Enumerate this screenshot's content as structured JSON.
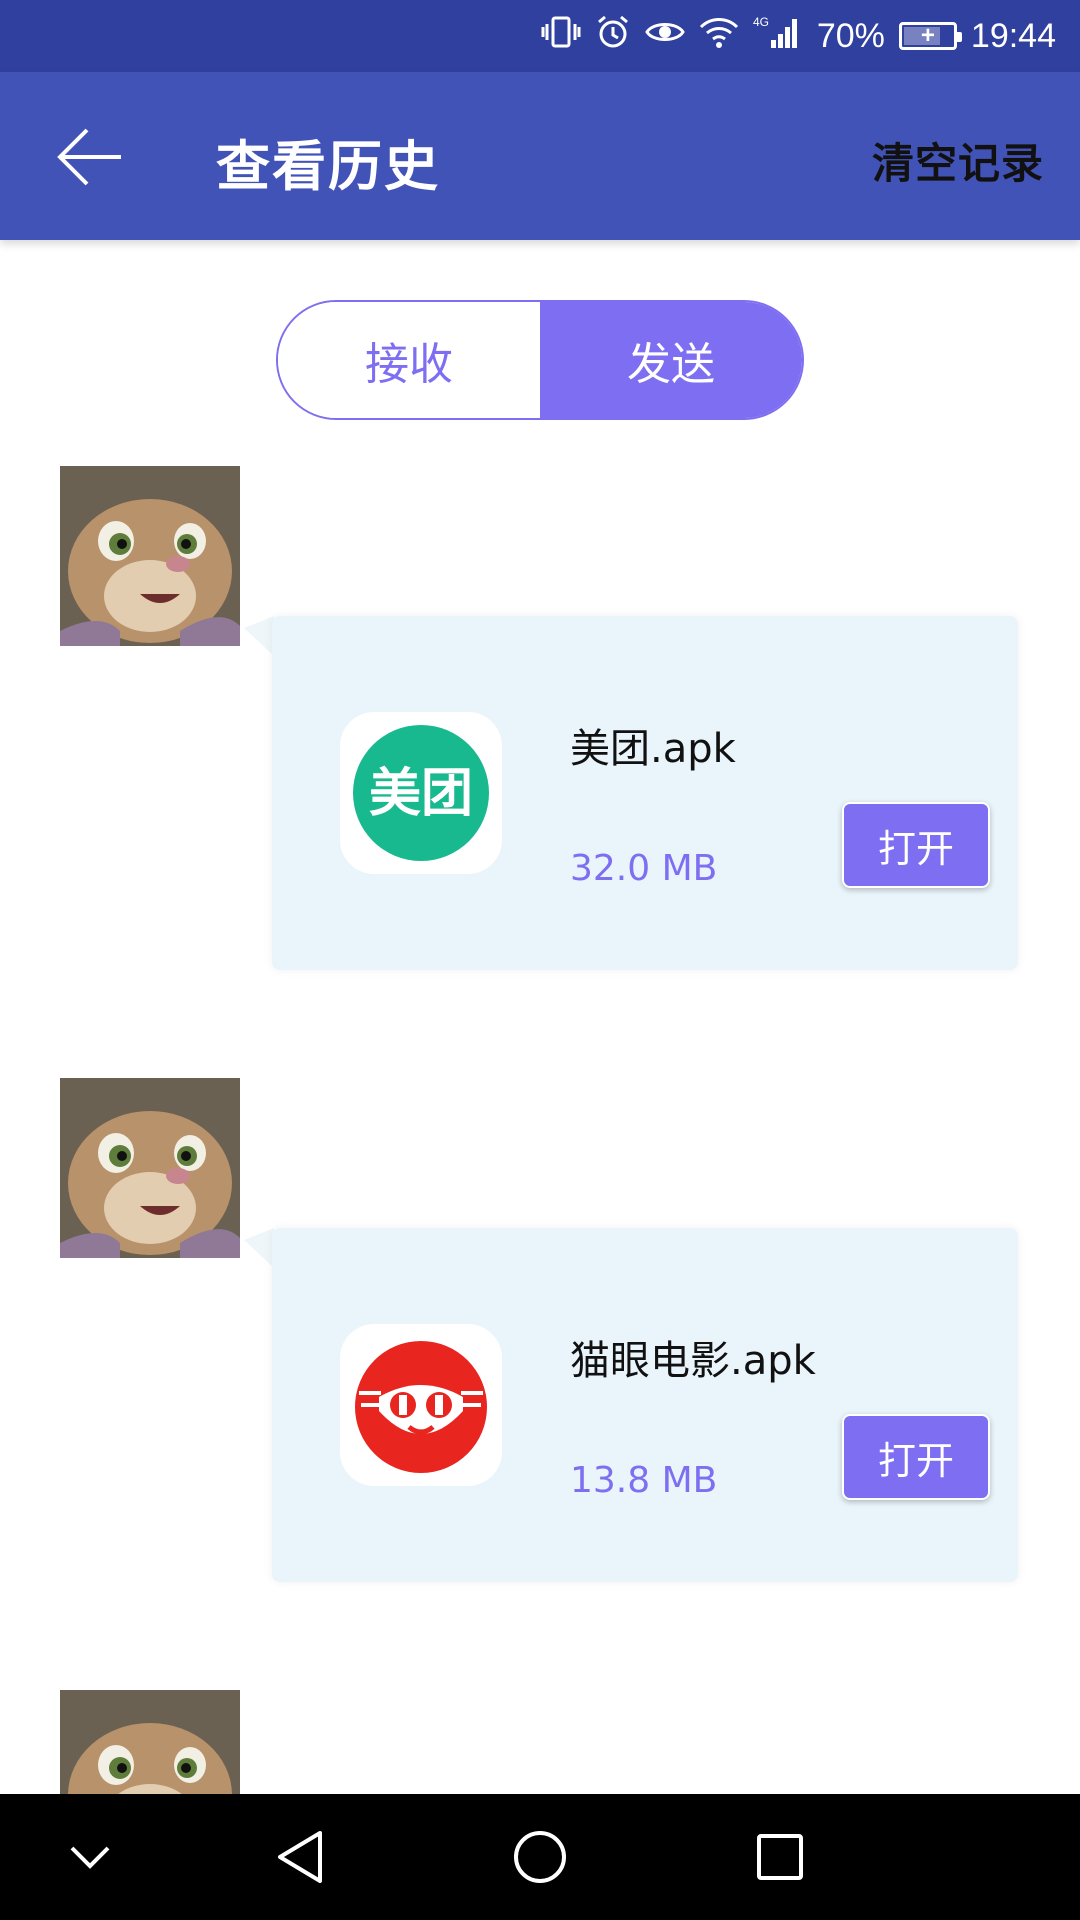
{
  "status_bar": {
    "battery": "70%",
    "time": "19:44",
    "network": "4G",
    "icons": [
      "vibrate-icon",
      "alarm-icon",
      "eye-icon",
      "wifi-icon",
      "signal-icon",
      "battery-icon"
    ]
  },
  "app_bar": {
    "title": "查看历史",
    "clear_label": "清空记录",
    "back_icon": "back-arrow-icon"
  },
  "tabs": [
    {
      "label": "接收",
      "selected": false
    },
    {
      "label": "发送",
      "selected": true
    }
  ],
  "messages": [
    {
      "file_name": "美团.apk",
      "size": "32.0 MB",
      "open_label": "打开",
      "icon_text": "美团",
      "icon_color": "#19b98f"
    },
    {
      "file_name": "猫眼电影.apk",
      "size": "13.8 MB",
      "open_label": "打开",
      "icon_color": "#e8251f"
    }
  ],
  "colors": {
    "status_bar": "#30409e",
    "app_bar": "#4253b8",
    "accent": "#7e6ef2",
    "bubble": "#e9f5fb"
  },
  "nav_bar": {
    "icons": [
      "collapse-icon",
      "back-triangle-icon",
      "home-circle-icon",
      "recents-square-icon"
    ]
  }
}
